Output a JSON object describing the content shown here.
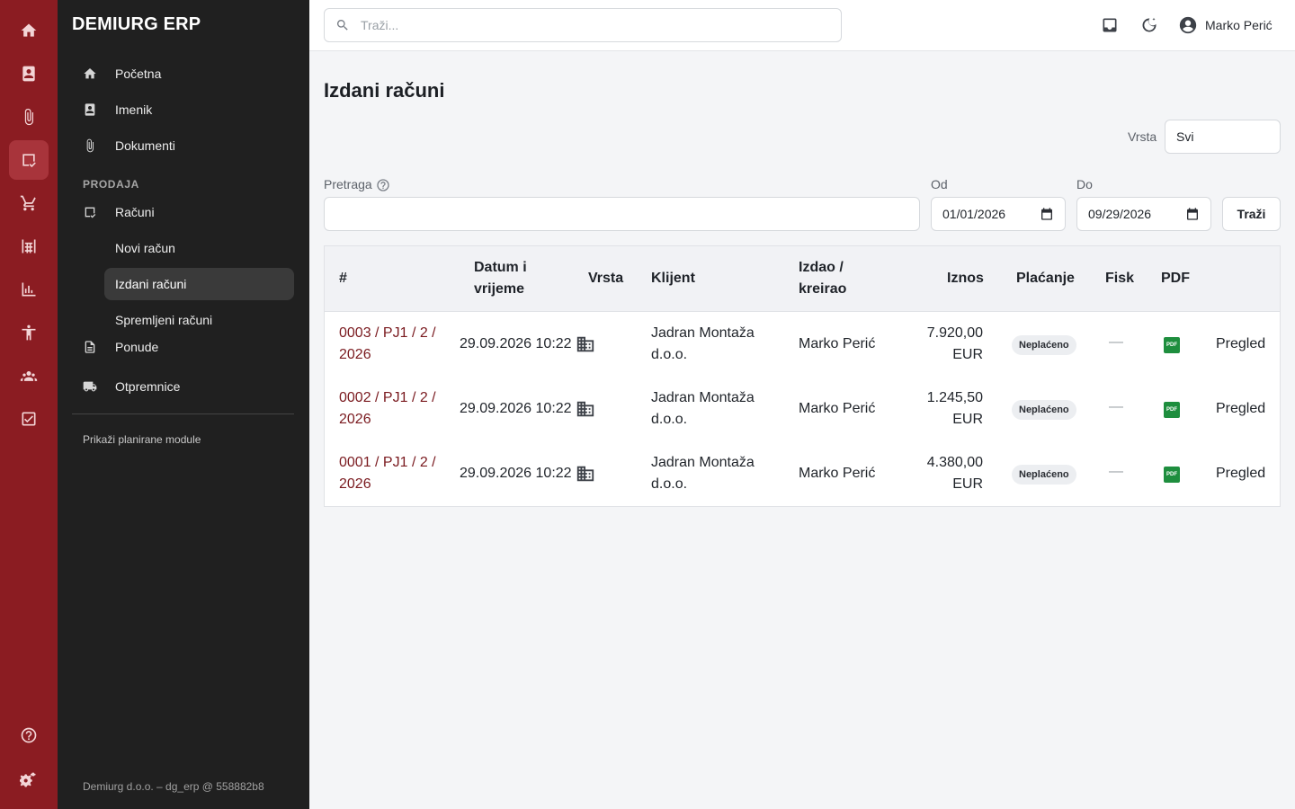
{
  "app": {
    "brand": "DEMIURG ERP",
    "footer": "Demiurg d.o.o. – dg_erp @ 558882b8"
  },
  "rail": {
    "items": [
      {
        "icon": "home-icon"
      },
      {
        "icon": "contacts-book-icon"
      },
      {
        "icon": "paperclip-icon"
      },
      {
        "icon": "invoice-icon",
        "active": true
      },
      {
        "icon": "cart-icon"
      },
      {
        "icon": "warehouse-icon"
      },
      {
        "icon": "analytics-icon"
      },
      {
        "icon": "accessibility-icon"
      },
      {
        "icon": "people-icon"
      },
      {
        "icon": "checkbox-icon"
      },
      {
        "icon": "help-icon"
      },
      {
        "icon": "settings-icon"
      }
    ]
  },
  "sidebar": {
    "items": [
      {
        "label": "Početna",
        "icon": "home-icon"
      },
      {
        "label": "Imenik",
        "icon": "contacts-book-icon"
      },
      {
        "label": "Dokumenti",
        "icon": "paperclip-icon"
      }
    ],
    "section_label": "PRODAJA",
    "sales": [
      {
        "label": "Računi",
        "icon": "invoice-icon"
      },
      {
        "label": "Novi račun"
      },
      {
        "label": "Izdani računi",
        "active": true
      },
      {
        "label": "Spremljeni računi"
      },
      {
        "label": "Ponude",
        "icon": "document-icon"
      },
      {
        "label": "Otpremnice",
        "icon": "truck-icon"
      }
    ],
    "planned_link": "Prikaži planirane module"
  },
  "topbar": {
    "search_placeholder": "Traži...",
    "user_name": "Marko Perić",
    "icons": [
      "inbox-icon",
      "dark-mode-icon",
      "account-circle-icon"
    ]
  },
  "page": {
    "title": "Izdani računi",
    "filters": {
      "type_label": "Vrsta",
      "type_value": "Svi",
      "search_label": "Pretraga",
      "search_value": "",
      "from_label": "Od",
      "from_value": "01/01/2026",
      "to_label": "Do",
      "to_value": "09/29/2026",
      "submit_label": "Traži"
    },
    "table": {
      "headers": {
        "num": "#",
        "datetime_1": "Datum i",
        "datetime_2": "vrijeme",
        "type": "Vrsta",
        "client": "Klijent",
        "issuer_1": "Izdao /",
        "issuer_2": "kreirao",
        "amount": "Iznos",
        "payment": "Plaćanje",
        "fisk": "Fisk",
        "pdf": "PDF"
      },
      "rows": [
        {
          "num_1": "0003 / PJ1 / 2 /",
          "num_2": "2026",
          "datetime": "29.09.2026 10:22",
          "type_icon": "building-icon",
          "client_1": "Jadran Montaža",
          "client_2": "d.o.o.",
          "issuer": "Marko Perić",
          "amount_1": "7.920,00",
          "amount_2": "EUR",
          "payment": "Neplaćeno",
          "fisk": "—",
          "pdf": "PDF",
          "action": "Pregled"
        },
        {
          "num_1": "0002 / PJ1 / 2 /",
          "num_2": "2026",
          "datetime": "29.09.2026 10:22",
          "type_icon": "building-icon",
          "client_1": "Jadran Montaža",
          "client_2": "d.o.o.",
          "issuer": "Marko Perić",
          "amount_1": "1.245,50",
          "amount_2": "EUR",
          "payment": "Neplaćeno",
          "fisk": "—",
          "pdf": "PDF",
          "action": "Pregled"
        },
        {
          "num_1": "0001 / PJ1 / 2 /",
          "num_2": "2026",
          "datetime": "29.09.2026 10:22",
          "type_icon": "building-icon",
          "client_1": "Jadran Montaža",
          "client_2": "d.o.o.",
          "issuer": "Marko Perić",
          "amount_1": "4.380,00",
          "amount_2": "EUR",
          "payment": "Neplaćeno",
          "fisk": "—",
          "pdf": "PDF",
          "action": "Pregled"
        }
      ]
    }
  }
}
